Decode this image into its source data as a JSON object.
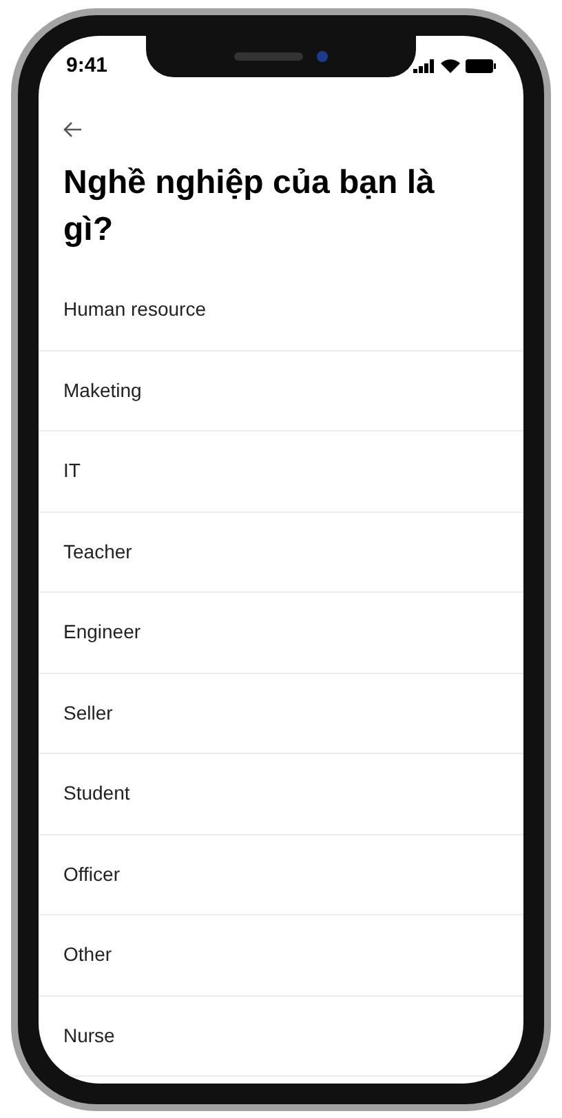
{
  "status_bar": {
    "time": "9:41"
  },
  "title": "Nghề nghiệp của bạn là gì?",
  "options": [
    {
      "label": "Human resource"
    },
    {
      "label": "Maketing"
    },
    {
      "label": "IT"
    },
    {
      "label": "Teacher"
    },
    {
      "label": "Engineer"
    },
    {
      "label": "Seller"
    },
    {
      "label": "Student"
    },
    {
      "label": "Officer"
    },
    {
      "label": "Other"
    },
    {
      "label": "Nurse"
    }
  ]
}
